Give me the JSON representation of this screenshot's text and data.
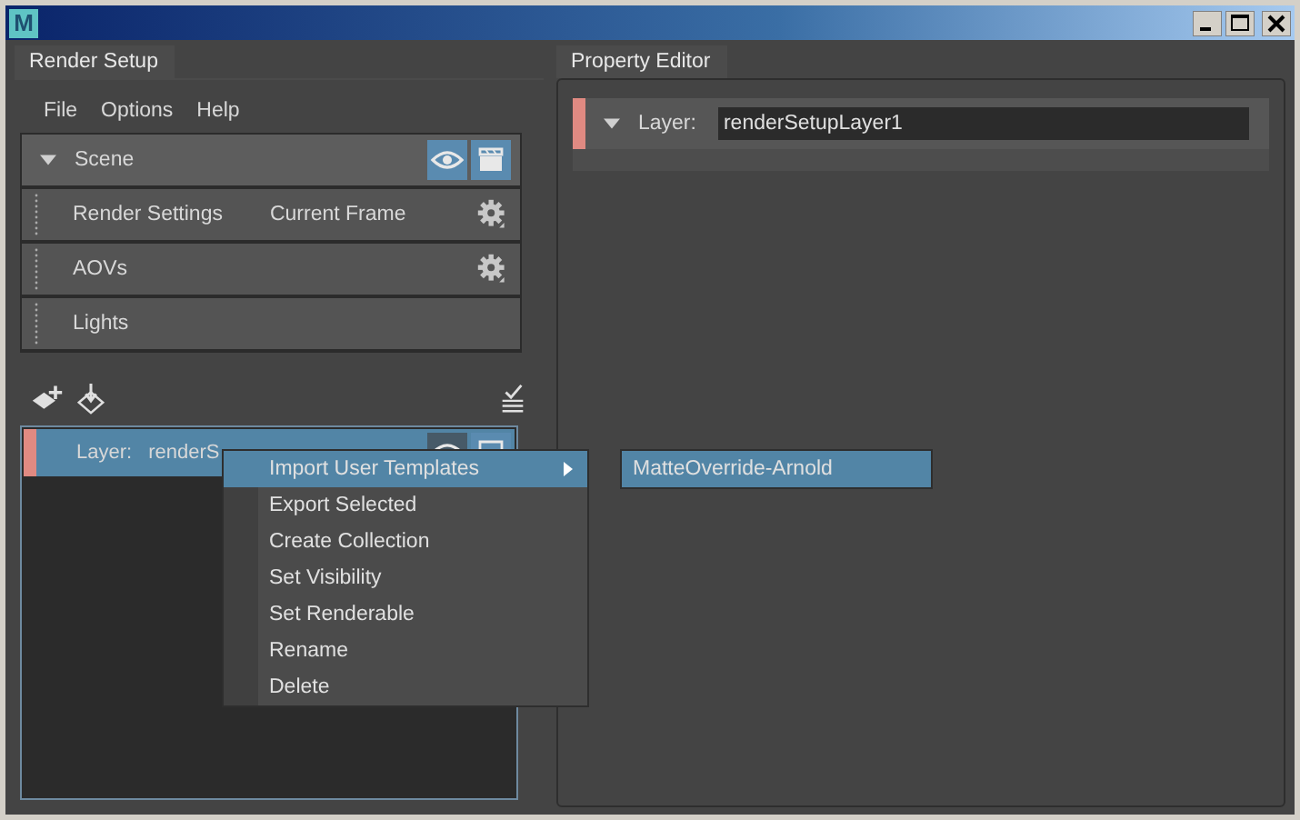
{
  "window": {
    "logo": "M"
  },
  "left_panel": {
    "tab": {
      "label": "Render Setup",
      "selected": true
    },
    "menu": [
      "File",
      "Options",
      "Help"
    ],
    "scene": {
      "label": "Scene",
      "expanded": true,
      "visible": true,
      "renderable": true
    },
    "scene_items": [
      {
        "label": "Render Settings",
        "value": "Current Frame",
        "settings": true
      },
      {
        "label": "AOVs",
        "settings": true
      },
      {
        "label": "Lights",
        "settings": false
      }
    ],
    "layers": [
      {
        "label": "Layer:",
        "name": "renderS",
        "selected": true
      }
    ]
  },
  "context_menu": {
    "items": [
      {
        "label": "Import User Templates",
        "selected": true,
        "submenu": true
      },
      {
        "label": "Export Selected",
        "selected": false,
        "submenu": false
      },
      {
        "label": "Create Collection",
        "selected": false,
        "submenu": false
      },
      {
        "label": "Set Visibility",
        "selected": false,
        "submenu": false
      },
      {
        "label": "Set Renderable",
        "selected": false,
        "submenu": false
      },
      {
        "label": "Rename",
        "selected": false,
        "submenu": false
      },
      {
        "label": "Delete",
        "selected": false,
        "submenu": false
      }
    ],
    "submenu": [
      {
        "label": "MatteOverride-Arnold",
        "selected": true
      }
    ]
  },
  "right_panel": {
    "tab": {
      "label": "Property Editor",
      "selected": true
    },
    "layer": {
      "label": "Layer:",
      "value": "renderSetupLayer1",
      "expanded": true
    }
  }
}
